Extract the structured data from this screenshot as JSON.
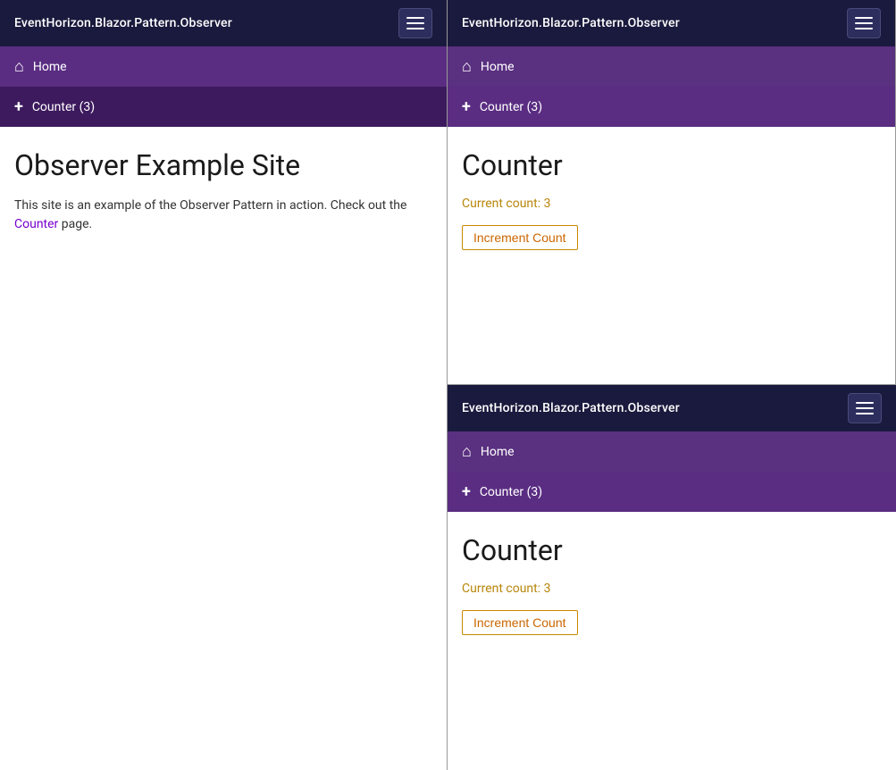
{
  "app": {
    "brand": "EventHorizon.Blazor.Pattern.Observer",
    "hamburger_label": "menu"
  },
  "nav": {
    "home_label": "Home",
    "counter_label": "Counter (3)"
  },
  "left_panel": {
    "page": "home",
    "home": {
      "title": "Observer Example Site",
      "intro": "This site is an example of the Observer Pattern in action. Check out the ",
      "link_text": "Counter",
      "intro_end": " page."
    }
  },
  "right_panel": {
    "page": "counter",
    "counter": {
      "title": "Counter",
      "current_count_label": "Current count: 3",
      "increment_button": "Increment Count"
    }
  },
  "bottom_panel": {
    "page": "counter",
    "counter": {
      "title": "Counter",
      "current_count_label": "Current count: 3",
      "increment_button": "Increment Count"
    }
  }
}
